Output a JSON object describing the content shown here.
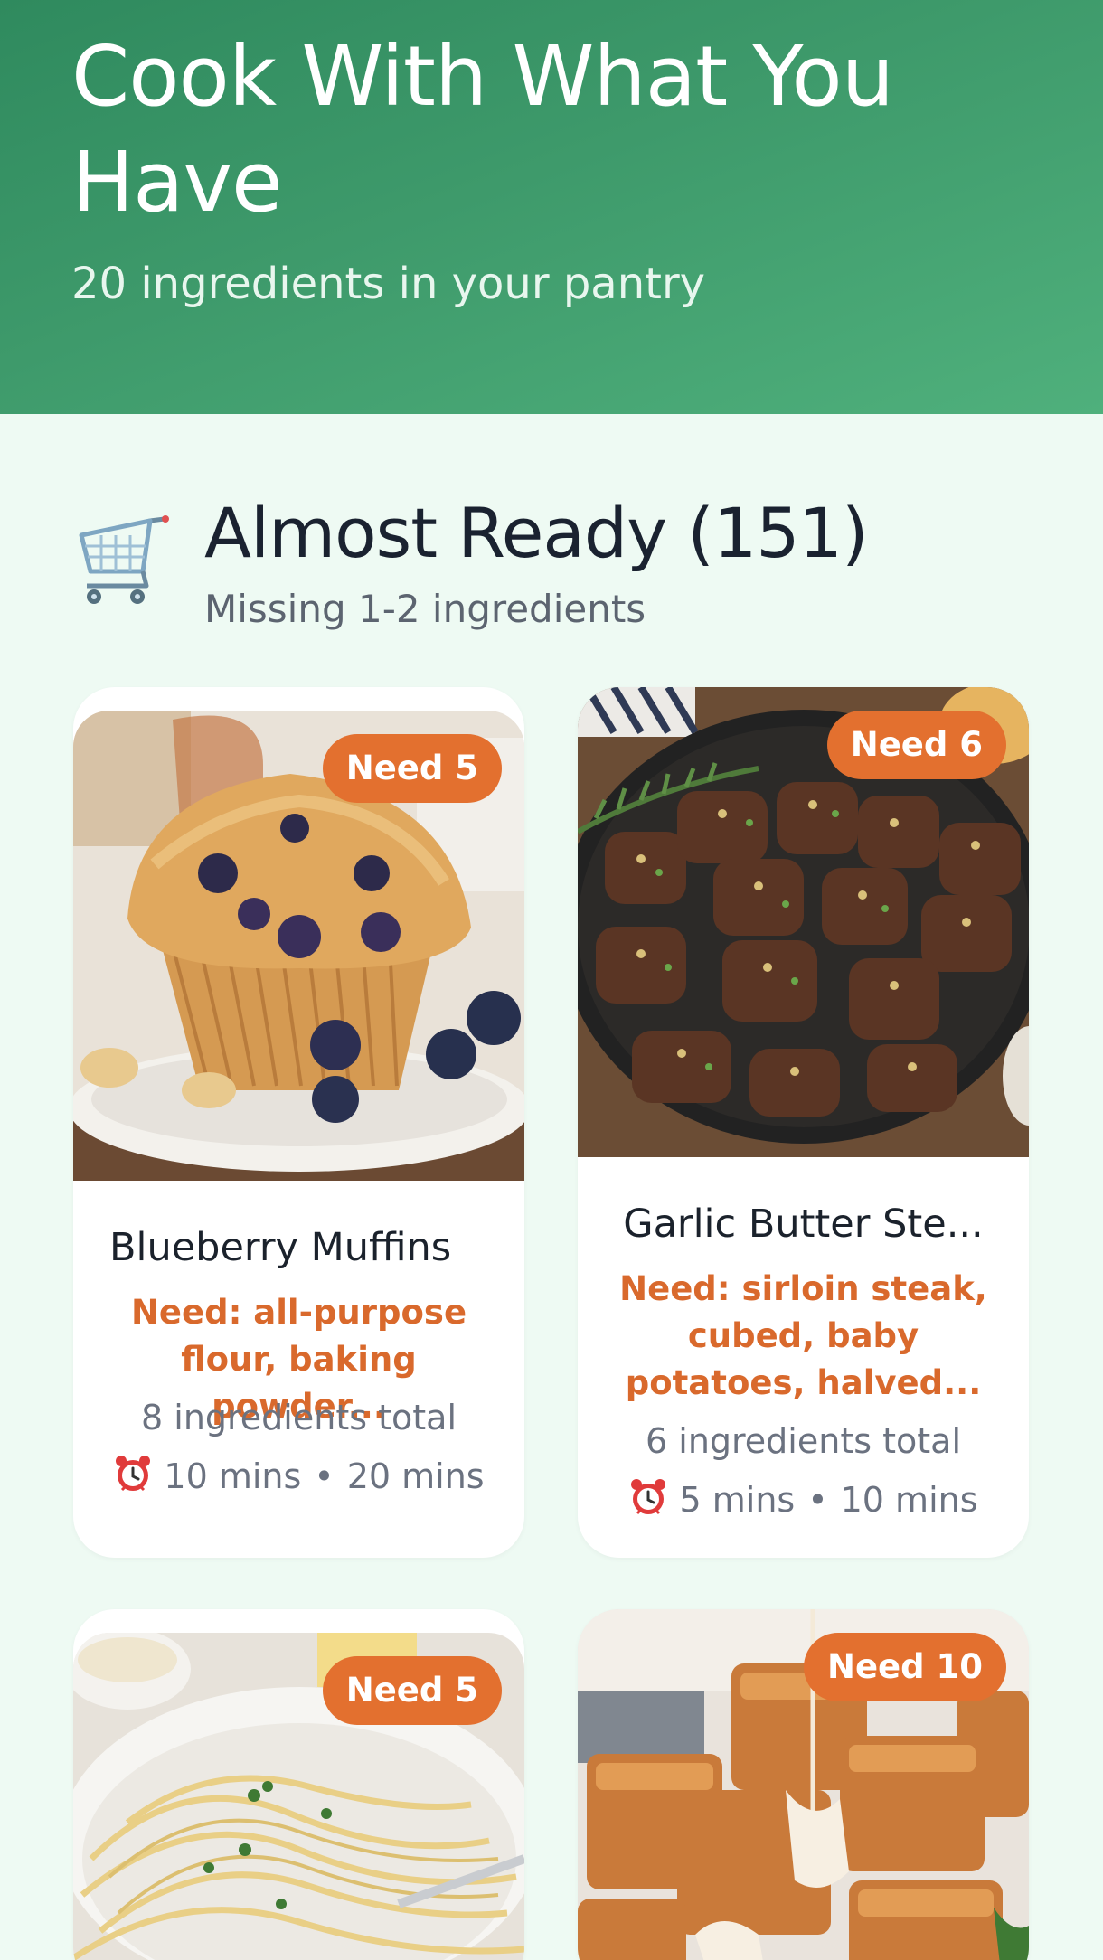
{
  "header": {
    "title": "Cook With What You Have",
    "subtitle": "20 ingredients in your pantry"
  },
  "section": {
    "icon": "shopping-cart-icon",
    "title": "Almost Ready (151)",
    "subtitle": "Missing 1-2 ingredients"
  },
  "recipes": [
    {
      "title": "Blueberry Muffins",
      "badge": "Need 5",
      "need": "Need: all-purpose flour, baking powder...",
      "total": "8 ingredients total",
      "prep": "10 mins",
      "cook": "20 mins",
      "separator": "•",
      "image": "blueberry-muffin-photo"
    },
    {
      "title": "Garlic Butter Ste...",
      "badge": "Need 6",
      "need": "Need: sirloin steak, cubed, baby potatoes, halved...",
      "total": "6 ingredients total",
      "prep": "5 mins",
      "cook": "10 mins",
      "separator": "•",
      "image": "garlic-butter-steak-bites-photo"
    },
    {
      "badge": "Need 5",
      "image": "spaghetti-pasta-photo"
    },
    {
      "badge": "Need 10",
      "image": "french-toast-bites-photo"
    }
  ],
  "colors": {
    "header_start": "#2f8a5e",
    "header_end": "#4fb07c",
    "background": "#eefaf3",
    "accent": "#e3702f",
    "need_text": "#d9692c"
  }
}
